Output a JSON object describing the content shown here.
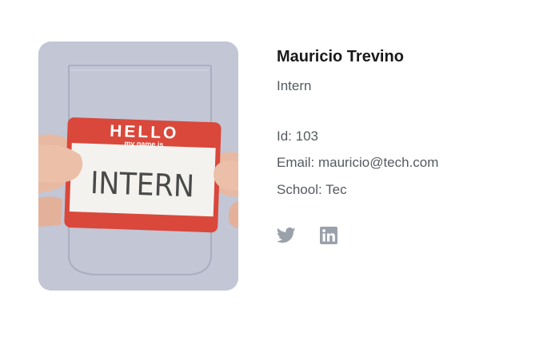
{
  "profile": {
    "name": "Mauricio Trevino",
    "role": "Intern",
    "photo": {
      "badge_top": "HELLO",
      "badge_sub": "my name is",
      "badge_name": "INTERN"
    },
    "details": {
      "id": "Id: 103",
      "email": "Email: mauricio@tech.com",
      "school": "School: Tec"
    },
    "socials": [
      {
        "icon": "twitter-icon"
      },
      {
        "icon": "linkedin-icon"
      }
    ]
  },
  "colors": {
    "name_text": "#1a1a1a",
    "body_text": "#555a60",
    "icon": "#9aa1aa",
    "badge_red": "#d9483b"
  }
}
